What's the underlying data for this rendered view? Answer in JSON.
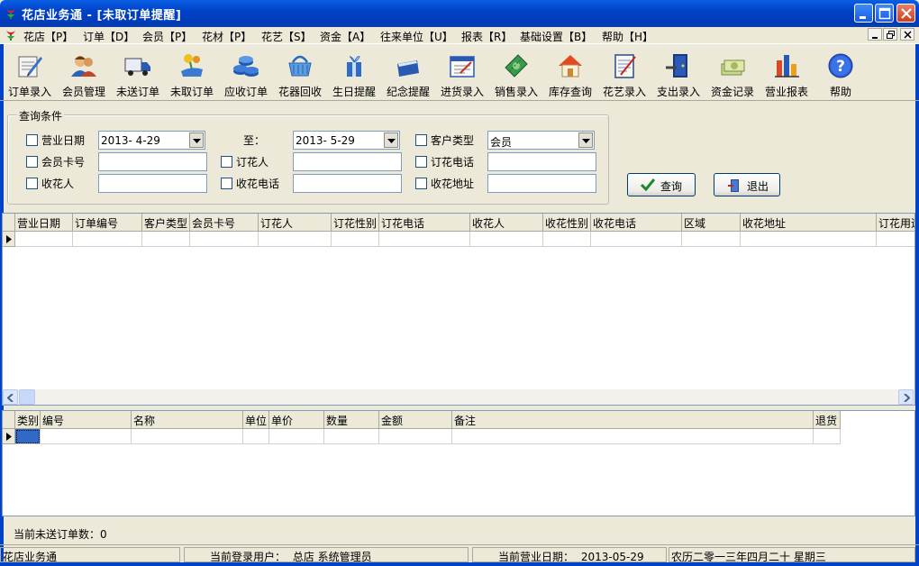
{
  "window": {
    "title": "花店业务通 - [未取订单提醒]"
  },
  "menu": [
    {
      "label": "花店【P】"
    },
    {
      "label": "订单【D】"
    },
    {
      "label": "会员【P】"
    },
    {
      "label": "花材【P】"
    },
    {
      "label": "花艺【S】"
    },
    {
      "label": "资金【A】"
    },
    {
      "label": "往来单位【U】"
    },
    {
      "label": "报表【R】"
    },
    {
      "label": "基础设置【B】"
    },
    {
      "label": "帮助【H】"
    }
  ],
  "toolbar": [
    {
      "label": "订单录入",
      "icon": "order-entry-icon"
    },
    {
      "label": "会员管理",
      "icon": "member-icon"
    },
    {
      "label": "未送订单",
      "icon": "truck-icon"
    },
    {
      "label": "未取订单",
      "icon": "flower-hand-icon"
    },
    {
      "label": "应收订单",
      "icon": "coins-icon"
    },
    {
      "label": "花器回收",
      "icon": "basket-icon"
    },
    {
      "label": "生日提醒",
      "icon": "gift-icon"
    },
    {
      "label": "纪念提醒",
      "icon": "card-icon"
    },
    {
      "label": "进货录入",
      "icon": "purchase-icon"
    },
    {
      "label": "销售录入",
      "icon": "money-icon"
    },
    {
      "label": "库存查询",
      "icon": "house-icon"
    },
    {
      "label": "花艺录入",
      "icon": "notebook-icon"
    },
    {
      "label": "支出录入",
      "icon": "door-icon"
    },
    {
      "label": "资金记录",
      "icon": "cash-icon"
    },
    {
      "label": "营业报表",
      "icon": "barchart-icon"
    },
    {
      "label": "帮助",
      "icon": "help-icon"
    }
  ],
  "query": {
    "group_title": "查询条件",
    "business_date_label": "营业日期",
    "date_from": "2013- 4-29",
    "to_label": "至：",
    "date_to": "2013- 5-29",
    "customer_type_label": "客户类型",
    "customer_type_value": "会员",
    "member_card_label": "会员卡号",
    "orderer_label": "订花人",
    "order_phone_label": "订花电话",
    "recipient_label": "收花人",
    "recipient_phone_label": "收花电话",
    "recipient_address_label": "收花地址",
    "query_button": "查询",
    "exit_button": "退出"
  },
  "orders_table": {
    "columns": [
      "营业日期",
      "订单编号",
      "客户类型",
      "会员卡号",
      "订花人",
      "订花性别",
      "订花电话",
      "收花人",
      "收花性别",
      "收花电话",
      "区域",
      "收花地址",
      "订花用途"
    ]
  },
  "items_table": {
    "columns": [
      "类别",
      "编号",
      "名称",
      "单位",
      "单价",
      "数量",
      "金额",
      "备注",
      "退货"
    ]
  },
  "footer": {
    "pending_count": "当前未送订单数：0"
  },
  "status": {
    "app_name": "花店业务通",
    "login_label": "当前登录用户：",
    "login_user": "总店   系统管理员",
    "date_label": "当前营业日期：",
    "business_date": "2013-05-29",
    "lunar_date": "农历二零一三年四月二十  星期三"
  },
  "colors": {
    "titlebar": "#0042c8",
    "face": "#ece9d8",
    "selected_cell": "#316ac5"
  }
}
